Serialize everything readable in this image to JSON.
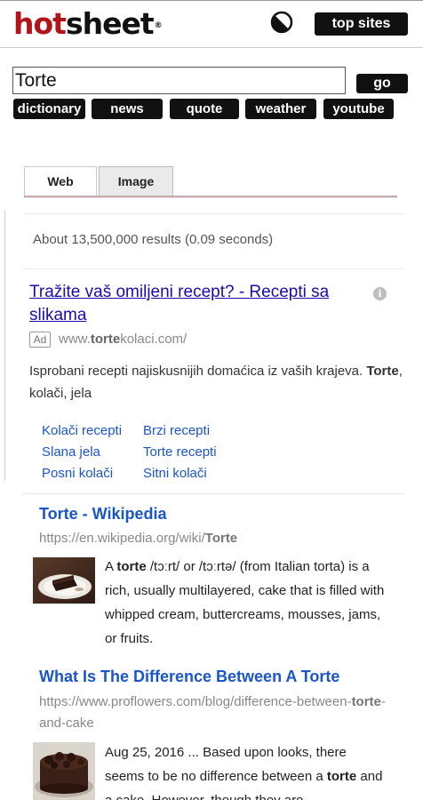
{
  "header": {
    "logo": {
      "part1": "hot",
      "part2": "sheet",
      "mark": "®"
    },
    "theme_icon": "contrast-toggle-icon",
    "top_sites_label": "top sites"
  },
  "search": {
    "query": "Torte",
    "placeholder": "",
    "go_label": "go",
    "quick_links": [
      "dictionary",
      "news",
      "quote",
      "weather",
      "youtube"
    ]
  },
  "tabs": [
    {
      "label": "Web",
      "active": true
    },
    {
      "label": "Image",
      "active": false
    }
  ],
  "stats": "About 13,500,000 results (0.09 seconds)",
  "ad": {
    "title": "Tražite vaš omiljeni recept? - Recepti sa slikama",
    "badge": "Ad",
    "url_prefix": "www.",
    "url_bold": "torte",
    "url_suffix": "kolaci.com/",
    "desc_start": "Isprobani recepti najiskusnijih domaćica iz vaših krajeva. ",
    "desc_bold": "Torte",
    "desc_end": ", kolači, jela",
    "sitelinks": [
      "Kolači recepti",
      "Brzi recepti",
      "Slana jela",
      "Torte recepti",
      "Posni kolači",
      "Sitni kolači"
    ]
  },
  "results": [
    {
      "title": "Torte - Wikipedia",
      "url_prefix": "https://en.wikipedia.org/wiki/",
      "url_bold": "Torte",
      "url_suffix": "",
      "snippet_start": "A ",
      "snippet_bold": "torte",
      "snippet_end": " /tɔːrt/ or /tɔːrtə/ (from Italian torta) is a rich, usually multilayered, cake that is filled with whipped cream, buttercreams, mousses, jams, or fruits."
    },
    {
      "title": "What Is The Difference Between A Torte",
      "url_prefix": "https://www.proflowers.com/blog/difference-between-",
      "url_bold": "torte",
      "url_suffix": "-and-cake",
      "snippet_start": "Aug 25, 2016 ... Based upon looks, there seems to be no difference between a ",
      "snippet_bold": "torte",
      "snippet_end": " and a cake. However, though they are"
    }
  ],
  "colors": {
    "brand_red": "#b2141a",
    "link_blue": "#1a56c8",
    "ad_link": "#1a0dab",
    "button_black": "#111111"
  }
}
